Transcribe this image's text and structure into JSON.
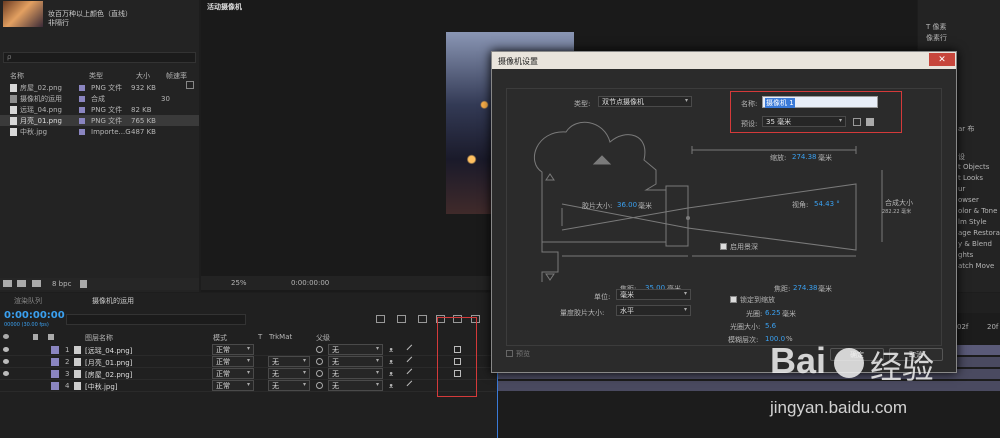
{
  "project": {
    "thumb_title": "妆百万种以上颜色（直线）",
    "thumb_sub": "非隔行",
    "search_placeholder": "ρ",
    "columns": {
      "name": "名称",
      "type": "类型",
      "size": "大小",
      "fps": "帧速率"
    },
    "items": [
      {
        "name": "房屋_02.png",
        "type": "PNG 文件",
        "size": "932 KB",
        "fps": "",
        "color": "#8a85c0"
      },
      {
        "name": "摄像机的运用",
        "type": "合成",
        "size": "",
        "fps": "30",
        "color": "#8a85c0"
      },
      {
        "name": "远瑶_04.png",
        "type": "PNG 文件",
        "size": "82 KB",
        "fps": "",
        "color": "#8a85c0"
      },
      {
        "name": "月亮_01.png",
        "type": "PNG 文件",
        "size": "765 KB",
        "fps": "",
        "color": "#8a85c0"
      },
      {
        "name": "中秋.jpg",
        "type": "Importe...G",
        "size": "487 KB",
        "fps": "",
        "color": "#8a85c0"
      }
    ],
    "bpc": "8 bpc"
  },
  "viewer": {
    "label": "活动摄像机",
    "zoom": "25%",
    "time": "0:00:00:00"
  },
  "timeline": {
    "tabs": [
      "渲染队列",
      "摄像机的运用"
    ],
    "time": "0:00:00:00",
    "frames": "00000 (30.00 fps)",
    "headers": {
      "source": "图层名称",
      "mode": "模式",
      "t": "T",
      "trkmat": "TrkMat",
      "parent": "父级"
    },
    "layers": [
      {
        "num": "1",
        "name": "[远瑶_04.png]",
        "mode": "正常",
        "trk": "",
        "parent": "无"
      },
      {
        "num": "2",
        "name": "[月亮_01.png]",
        "mode": "正常",
        "trk": "无",
        "parent": "无"
      },
      {
        "num": "3",
        "name": "[房屋_02.png]",
        "mode": "正常",
        "trk": "无",
        "parent": "无"
      },
      {
        "num": "4",
        "name": "[中秋.jpg]",
        "mode": "正常",
        "trk": "无",
        "parent": "无"
      }
    ],
    "ruler_marks": [
      "02f",
      "20f"
    ]
  },
  "right_panel": {
    "top_values": [
      "T 像素",
      "像素行"
    ],
    "items": [
      "设",
      "t Objects",
      "t Looks",
      "ur",
      "owser",
      "olor & Tone",
      "lm Style",
      "age Restora",
      "y & Blend",
      "ghts",
      "atch Move"
    ],
    "label2": "ar 布"
  },
  "dialog": {
    "title": "摄像机设置",
    "type_label": "类型:",
    "type_value": "双节点摄像机",
    "name_label": "名称:",
    "name_value": "摄像机 1",
    "preset_label": "预设:",
    "preset_value": "35 毫米",
    "zoom_label": "缩放:",
    "zoom_value": "274.38",
    "zoom_unit": "毫米",
    "film_label": "胶片大小:",
    "film_value": "36.00",
    "film_unit": "毫米",
    "angle_label": "视角:",
    "angle_value": "54.43 °",
    "comp_label": "合成大小",
    "comp_value": "282.22 毫米",
    "focal_label": "焦距:",
    "focal_value": "35.00",
    "focal_unit": "毫米",
    "dof_label": "启用景深",
    "focusdist_label": "焦距:",
    "focusdist_value": "274.38",
    "focusdist_unit": "毫米",
    "lock_label": "锁定到缩放",
    "aperture_label": "光圈:",
    "aperture_value": "6.25",
    "aperture_unit": "毫米",
    "fstop_label": "光圈大小:",
    "fstop_value": "5.6",
    "blur_label": "模糊层次:",
    "blur_value": "100.0",
    "blur_unit": "%",
    "units_label": "单位:",
    "units_value": "毫米",
    "measure_label": "量度胶片大小:",
    "measure_value": "水平",
    "preview_label": "预览",
    "ok_label": "确定",
    "cancel_label": "取消"
  },
  "watermark": {
    "logo": "Bai",
    "logo2": "经验",
    "url": "jingyan.baidu.com"
  },
  "colors": {
    "accent": "#3aa0f0",
    "highlight_box": "#d43a3a",
    "dialog_bg": "#2b2b2b",
    "titlebar": "#e9e4dc"
  }
}
